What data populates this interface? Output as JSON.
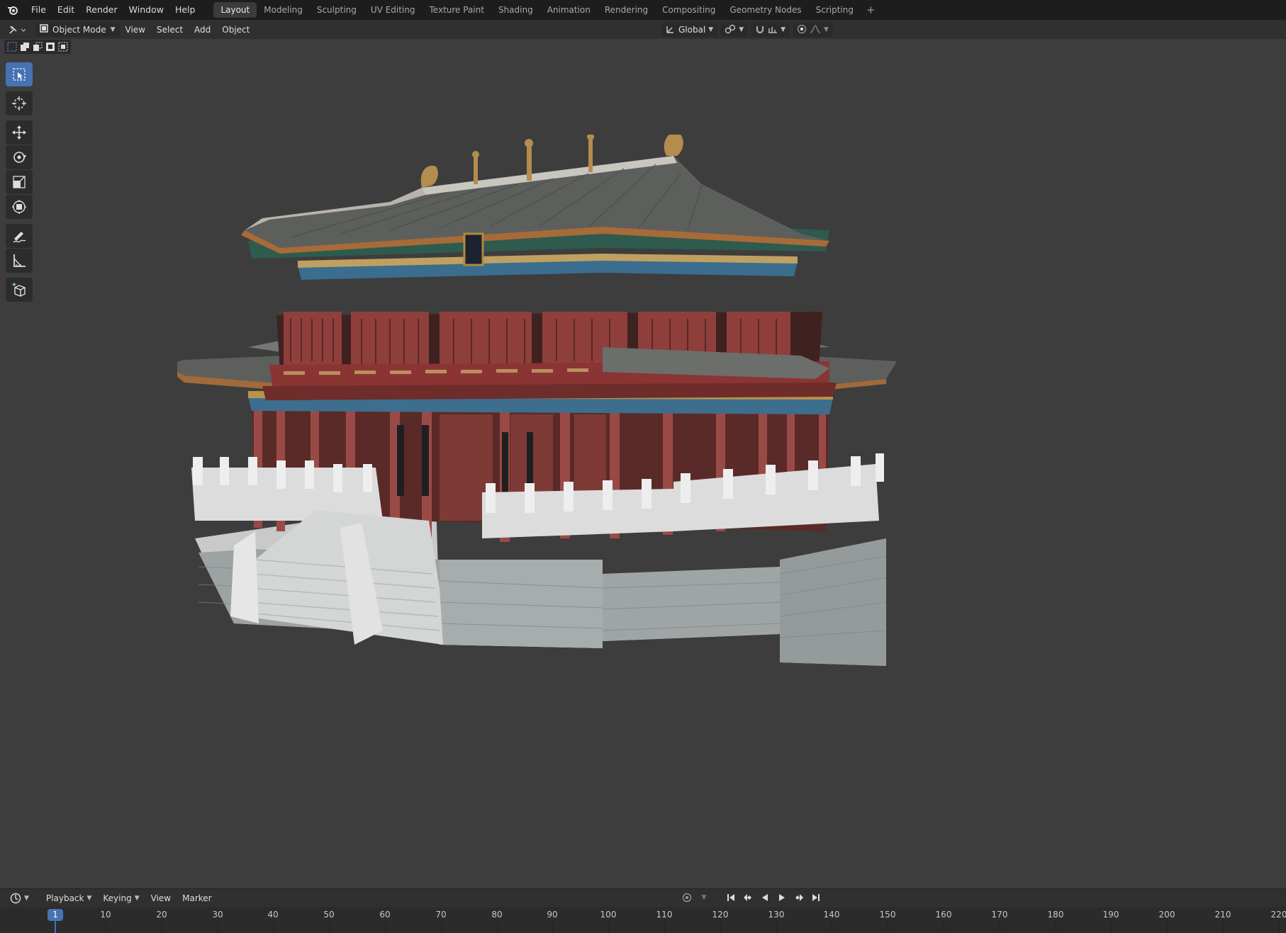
{
  "app": {
    "menus": [
      "File",
      "Edit",
      "Render",
      "Window",
      "Help"
    ],
    "workspaces": [
      "Layout",
      "Modeling",
      "Sculpting",
      "UV Editing",
      "Texture Paint",
      "Shading",
      "Animation",
      "Rendering",
      "Compositing",
      "Geometry Nodes",
      "Scripting"
    ],
    "active_workspace": "Layout",
    "add_workspace_icon": "plus-icon"
  },
  "viewport_header": {
    "mode": "Object Mode",
    "menus": [
      "View",
      "Select",
      "Add",
      "Object"
    ],
    "orientation": "Global"
  },
  "toolbar": {
    "tools": [
      "select-box-icon",
      "cursor-icon",
      "move-icon",
      "rotate-icon",
      "scale-icon",
      "transform-icon",
      "annotate-icon",
      "measure-icon",
      "add-cube-icon"
    ],
    "active": "select-box-icon"
  },
  "timeline": {
    "menus": [
      "Playback",
      "Keying",
      "View",
      "Marker"
    ],
    "current_frame": "1",
    "frame_labels": [
      "10",
      "20",
      "30",
      "40",
      "50",
      "60",
      "70",
      "80",
      "90",
      "100",
      "110",
      "120",
      "130",
      "140",
      "150",
      "160",
      "170",
      "180",
      "190",
      "200",
      "210",
      "220"
    ]
  },
  "colors": {
    "accent": "#4772b3",
    "viewport_bg": "#3d3d3d",
    "topbar_bg": "#1d1d1d",
    "header_bg": "#303030"
  }
}
